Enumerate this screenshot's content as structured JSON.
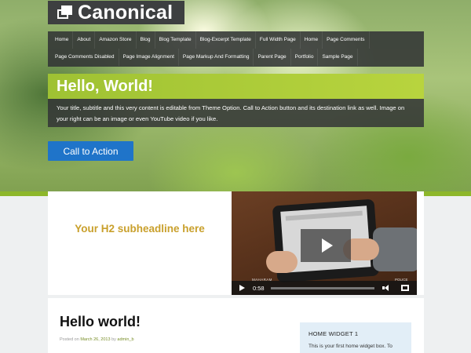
{
  "site": {
    "title": "Canonical"
  },
  "nav": {
    "items": [
      "Home",
      "About",
      "Amazon Store",
      "Blog",
      "Blog Template",
      "Blog-Excerpt Template",
      "Full Width Page",
      "Home",
      "Page Comments",
      "Page Comments Disabled",
      "Page Image Alignment",
      "Page Markup And Formatting",
      "Parent Page",
      "Portfolio",
      "Sample Page"
    ]
  },
  "hero": {
    "heading": "Hello, World!",
    "text": "Your title, subtitle and this very content is editable from Theme Option. Call to Action button and its destination link as well. Image on your right can be an image or even YouTube video if you like.",
    "cta_label": "Call to Action"
  },
  "feature": {
    "subheadline": "Your H2 subheadline here",
    "video": {
      "time": "0:58",
      "brand_label": "MAHARAM",
      "corner_label": "POLICE"
    }
  },
  "post": {
    "title": "Hello world!",
    "meta_prefix": "Posted on",
    "date": "March 26, 2013",
    "meta_by": "by",
    "author": "admin_b"
  },
  "widget": {
    "title": "HOME WIDGET 1",
    "text": "This is your first home widget box. To"
  },
  "colors": {
    "accent_green": "#9fc233",
    "cta_blue": "#1f74c9",
    "subheadline_gold": "#c9a02c",
    "widget_bg": "#e2eef7"
  }
}
